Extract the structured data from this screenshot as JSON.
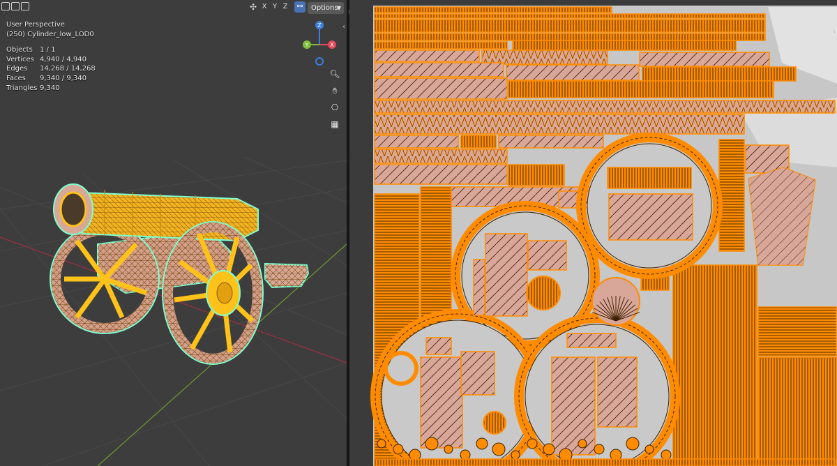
{
  "viewport": {
    "header": {
      "axes": [
        "X",
        "Y",
        "Z"
      ],
      "options_label": "Options"
    },
    "info": {
      "view": "User Perspective",
      "object_name": "(250) Cylinder_low_LOD0",
      "stats": [
        {
          "label": "Objects",
          "value": "1 / 1"
        },
        {
          "label": "Vertices",
          "value": "4,940 / 4,940"
        },
        {
          "label": "Edges",
          "value": "14,268 / 14,268"
        },
        {
          "label": "Faces",
          "value": "9,340 / 9,340"
        },
        {
          "label": "Triangles",
          "value": "9,340"
        }
      ]
    },
    "gizmo": {
      "z": "Z",
      "y": "Y",
      "x": "X"
    },
    "tools": [
      "zoom-icon",
      "hand-pan-icon",
      "camera-icon",
      "grid-perspective-icon"
    ]
  },
  "colors": {
    "viewport_bg": "#3d3d3d",
    "uv_bg": "#3b3b3b",
    "uv_fill": "#d9a79a",
    "uv_edge": "#ff8c00",
    "wire_selected": "#ffb000",
    "wire_active": "#7dffd0",
    "axis_x": "#e04a5a",
    "axis_y": "#7dbf3a",
    "axis_z": "#3b7fe0"
  }
}
